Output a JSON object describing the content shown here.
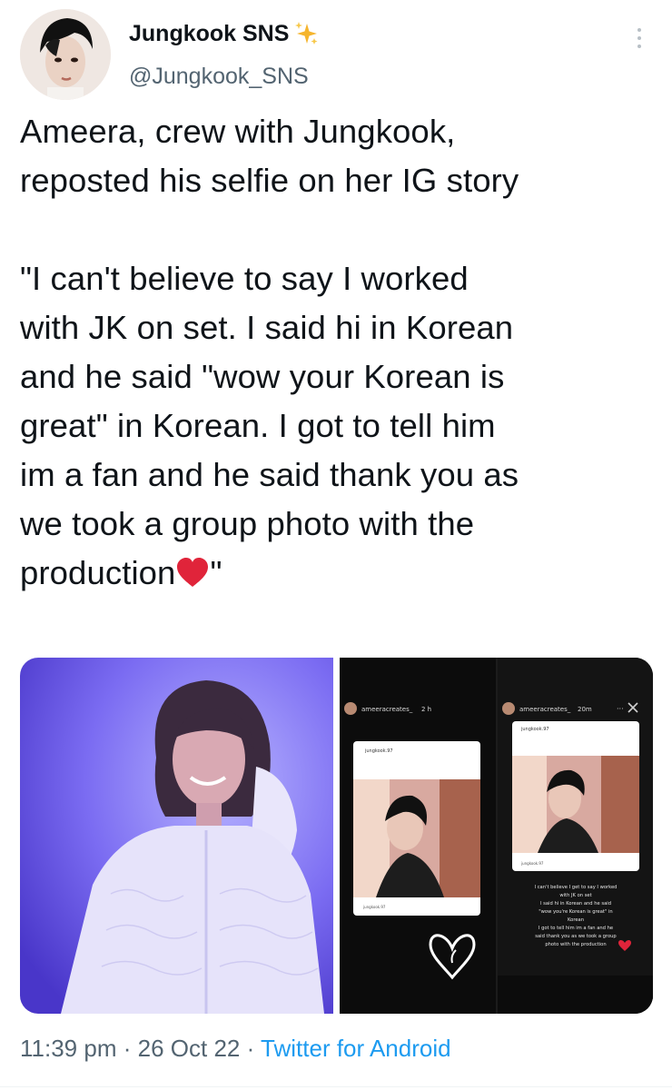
{
  "tweet": {
    "display_name": "Jungkook SNS",
    "handle": "@Jungkook_SNS",
    "text_lines": [
      "Ameera, crew with Jungkook,",
      "reposted his selfie on her IG story",
      "",
      "\"I can't believe to say I worked",
      "with JK on set. I said hi in Korean",
      "and he said \"wow your Korean is",
      "great\" in Korean. I got to tell him",
      "im a fan and he said thank you as",
      "we took a group photo with the",
      "production"
    ],
    "text_end_suffix": "\"",
    "time": "11:39 pm",
    "date": "26 Oct 22",
    "separator": "·",
    "source": "Twitter for Android"
  },
  "icons": {
    "verified_emoji": "sparkles-icon",
    "more": "more-options-icon",
    "heart": "red-heart-emoji"
  },
  "story_left": {
    "username": "ameeracreates_",
    "time": "2 h",
    "post_user": "jungkook.97",
    "caption_user": "jungkook.97"
  },
  "story_right": {
    "username": "ameeracreates_",
    "time": "20m",
    "post_user": "jungkook.97",
    "caption_user": "jungkook.97",
    "caption_lines": [
      "I can't believe I get to say I worked",
      "with JK on set",
      "I said hi in Korean and he said",
      "\"wow you're Korean is great\" in",
      "Korean",
      "I got to tell him im a fan and he",
      "said thank you as we took a group",
      "photo with the production"
    ]
  },
  "colors": {
    "text": "#0f1419",
    "secondary": "#536471",
    "link": "#1d9bf0",
    "heart": "#e0243a"
  }
}
